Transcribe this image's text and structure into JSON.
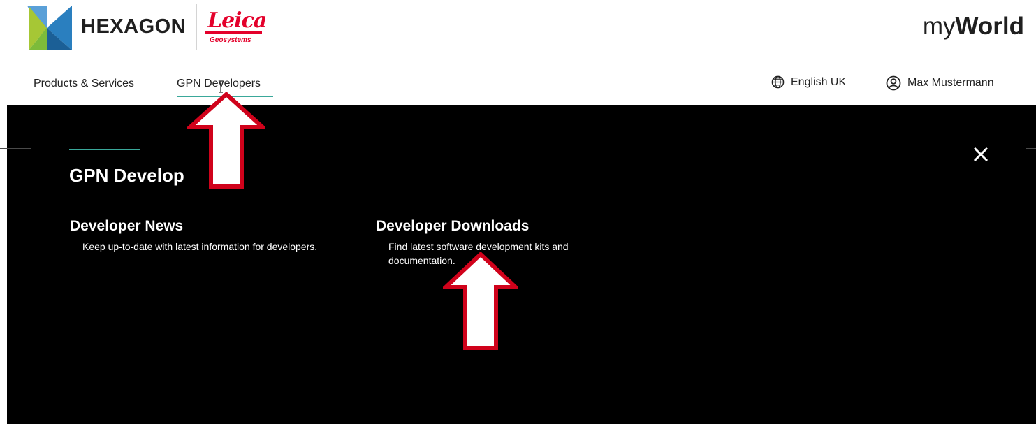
{
  "header": {
    "brand": "HEXAGON",
    "partner_name": "Leica",
    "partner_sub": "Geosystems",
    "app_title_light": "my",
    "app_title_bold": "World"
  },
  "nav": {
    "items": [
      {
        "label": "Products & Services"
      },
      {
        "label": "GPN Developers"
      }
    ],
    "language": "English UK",
    "user": "Max Mustermann"
  },
  "panel": {
    "title": "GPN Develop",
    "links": [
      {
        "title": "Developer News",
        "desc": "Keep up-to-date with latest information for developers."
      },
      {
        "title": "Developer Downloads",
        "desc": "Find latest software development kits and documentation."
      }
    ]
  },
  "icons": {
    "globe": "globe-icon",
    "user": "user-icon",
    "close": "close-icon",
    "arrow": "arrow-up-icon"
  },
  "colors": {
    "accent": "#3aa89a",
    "arrow_border": "#d0021b",
    "leica_red": "#e4002b",
    "panel_bg": "#000000"
  }
}
